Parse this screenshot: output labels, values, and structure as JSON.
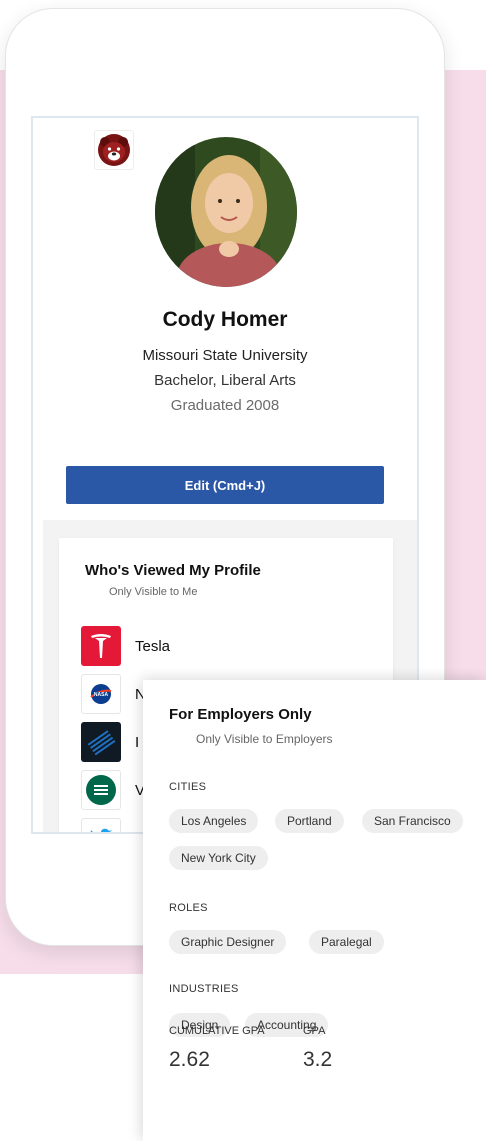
{
  "profile": {
    "name": "Cody Homer",
    "school": "Missouri State University",
    "degree": "Bachelor, Liberal Arts",
    "graduated": "Graduated 2008",
    "school_logo_icon": "bear-mascot-icon",
    "edit_label": "Edit (Cmd+J)"
  },
  "viewed": {
    "title": "Who's Viewed My Profile",
    "subtitle": "Only Visible to Me",
    "companies": [
      {
        "name": "Tesla",
        "icon": "tesla-logo-icon",
        "color": "#e31937"
      },
      {
        "name": "N",
        "icon": "nasa-logo-icon",
        "color": "#0b3d91"
      },
      {
        "name": "I",
        "icon": "ibm-logo-icon",
        "color": "#1f70c1"
      },
      {
        "name": "V",
        "icon": "whole-foods-logo-icon",
        "color": "#00674b"
      },
      {
        "name": "",
        "icon": "twitter-logo-icon",
        "color": "#1da1f2"
      }
    ]
  },
  "employers": {
    "title": "For Employers Only",
    "subtitle": "Only Visible to Employers",
    "cities_label": "CITIES",
    "cities": [
      "Los Angeles",
      "Portland",
      "San Francisco",
      "New York City"
    ],
    "roles_label": "ROLES",
    "roles": [
      "Graphic Designer",
      "Paralegal"
    ],
    "industries_label": "INDUSTRIES",
    "industries": [
      "Design",
      "Accounting"
    ],
    "gpa": [
      {
        "label": "CUMULATIVE GPA",
        "value": "2.62"
      },
      {
        "label": "GPA",
        "value": "3.2"
      }
    ]
  },
  "colors": {
    "accent": "#2b57a7",
    "background": "#f6dde9"
  }
}
